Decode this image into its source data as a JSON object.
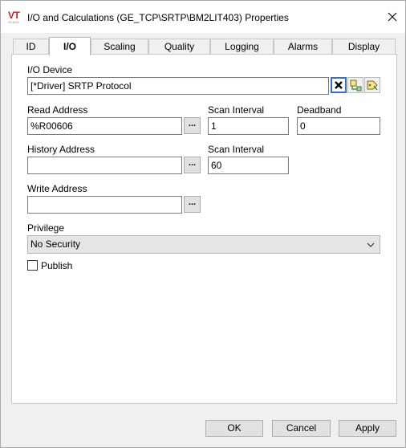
{
  "window": {
    "title": "I/O and Calculations (GE_TCP\\SRTP\\BM2LIT403) Properties",
    "logo_text": "VT",
    "logo_sub": "SCADA"
  },
  "tabs": [
    {
      "label": "ID",
      "active": false
    },
    {
      "label": "I/O",
      "active": true
    },
    {
      "label": "Scaling",
      "active": false
    },
    {
      "label": "Quality",
      "active": false
    },
    {
      "label": "Logging",
      "active": false
    },
    {
      "label": "Alarms",
      "active": false
    },
    {
      "label": "Display",
      "active": false
    }
  ],
  "io_device": {
    "label": "I/O Device",
    "value": "[*Driver]    SRTP Protocol"
  },
  "read_address": {
    "label": "Read Address",
    "value": "%R00606",
    "browse": "..."
  },
  "scan_interval_read": {
    "label": "Scan Interval",
    "value": "1"
  },
  "deadband": {
    "label": "Deadband",
    "value": "0"
  },
  "history_address": {
    "label": "History Address",
    "value": "",
    "browse": "..."
  },
  "scan_interval_history": {
    "label": "Scan Interval",
    "value": "60"
  },
  "write_address": {
    "label": "Write Address",
    "value": "",
    "browse": "..."
  },
  "privilege": {
    "label": "Privilege",
    "selected": "No Security"
  },
  "publish": {
    "label": "Publish",
    "checked": false
  },
  "buttons": {
    "ok": "OK",
    "cancel": "Cancel",
    "apply": "Apply"
  },
  "colors": {
    "accent": "#3370c6",
    "logo": "#cc1f1f"
  }
}
